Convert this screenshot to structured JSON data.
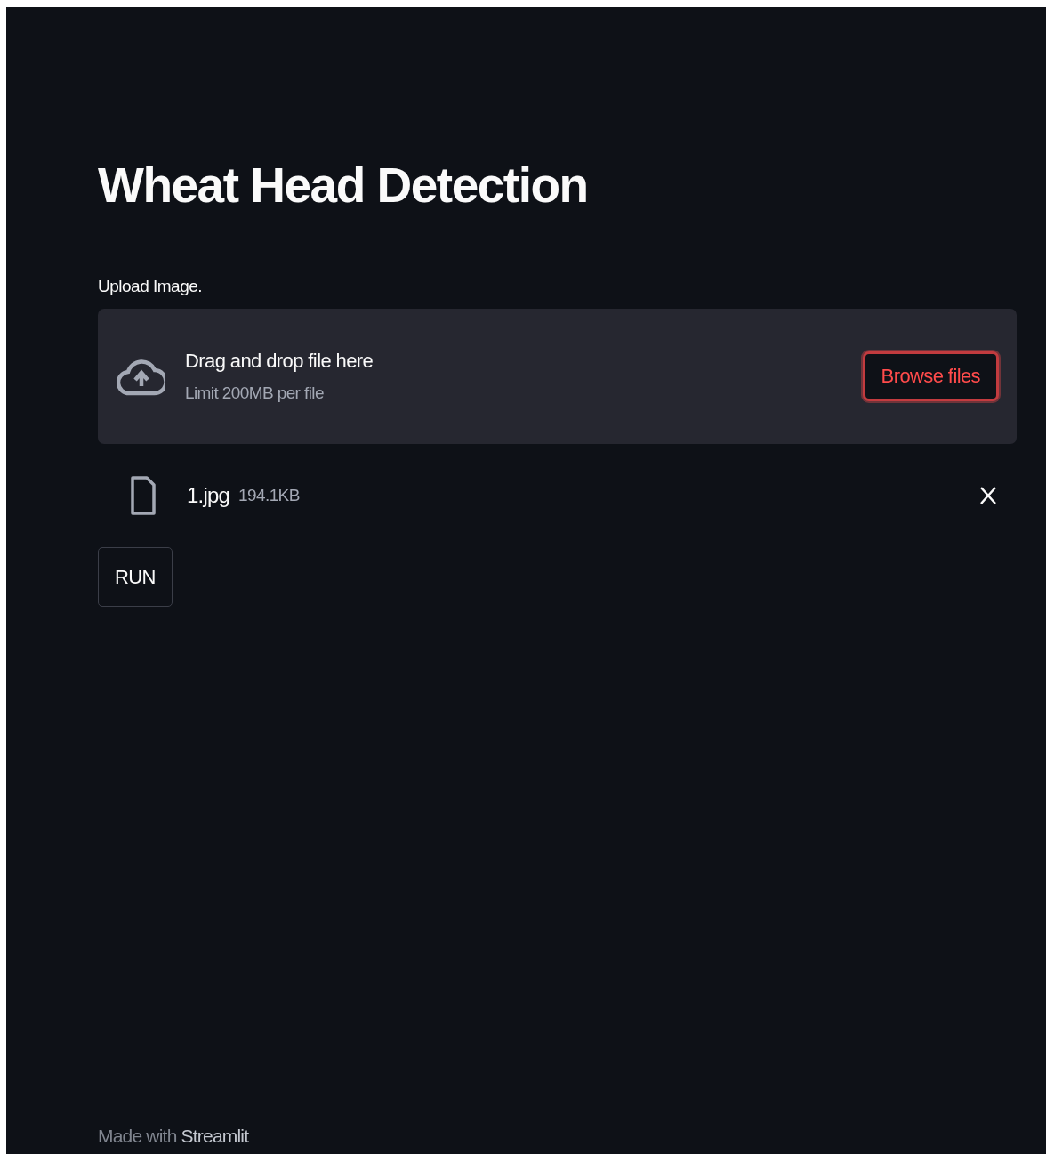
{
  "title": "Wheat Head Detection",
  "uploader": {
    "label": "Upload Image.",
    "instructions": "Drag and drop file here",
    "limit": "Limit 200MB per file",
    "button": "Browse files"
  },
  "files": [
    {
      "name": "1.jpg",
      "size": "194.1KB"
    }
  ],
  "run_button": "RUN",
  "footer": {
    "text": "Made with",
    "link": "Streamlit"
  }
}
